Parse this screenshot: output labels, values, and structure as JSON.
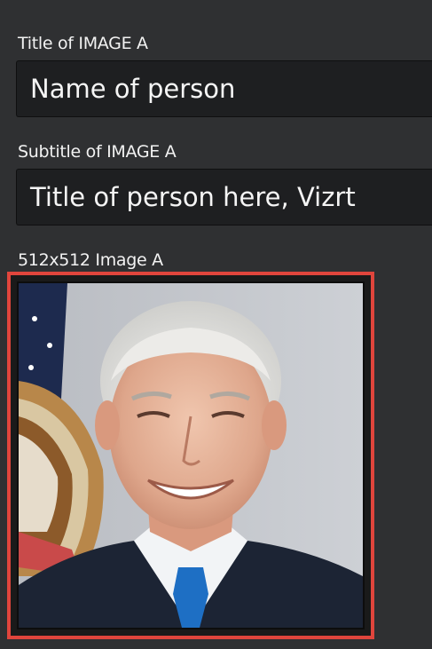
{
  "fields": {
    "title_label": "Title of IMAGE A",
    "title_value": "Name of person",
    "subtitle_label": "Subtitle of IMAGE A",
    "subtitle_value": "Title of person here, Vizrt",
    "image_label": "512x512 Image A"
  },
  "colors": {
    "panel_background": "#2f3032",
    "input_background": "#1e1f21",
    "selection_border": "#e0453c"
  }
}
